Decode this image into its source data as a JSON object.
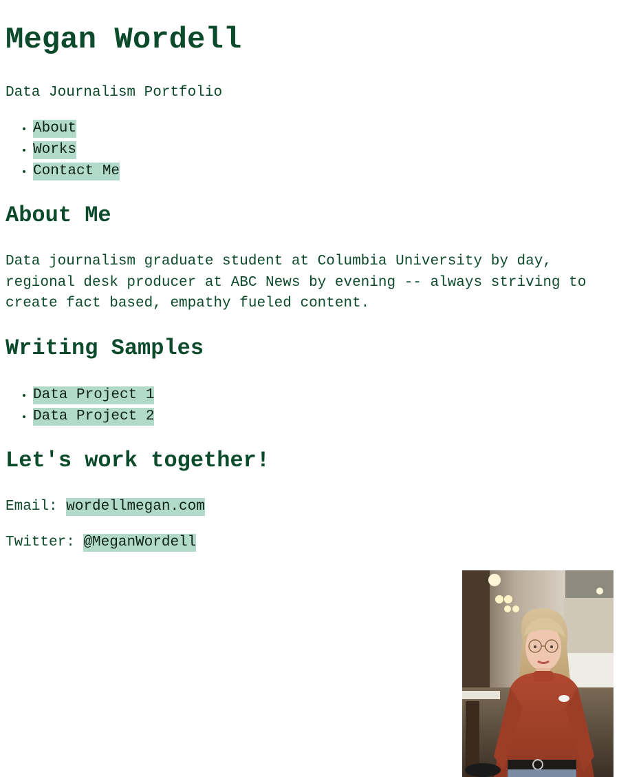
{
  "header": {
    "title": "Megan Wordell",
    "subtitle": "Data Journalism Portfolio"
  },
  "nav": {
    "items": [
      {
        "label": "About"
      },
      {
        "label": "Works"
      },
      {
        "label": "Contact Me"
      }
    ]
  },
  "about": {
    "heading": "About Me",
    "text": "Data journalism graduate student at Columbia University by day, regional desk producer at ABC News by evening -- always striving to create fact based, empathy fueled content."
  },
  "writing": {
    "heading": "Writing Samples",
    "items": [
      {
        "label": "Data Project 1"
      },
      {
        "label": "Data Project 2"
      }
    ]
  },
  "contact": {
    "heading": "Let's work together!",
    "email_label": "Email:",
    "email_value": "wordellmegan.com",
    "twitter_label": "Twitter:",
    "twitter_value": "@MeganWordell"
  },
  "colors": {
    "text": "#0c4a2c",
    "highlight": "#b2dacb",
    "background": "#ffffff"
  }
}
